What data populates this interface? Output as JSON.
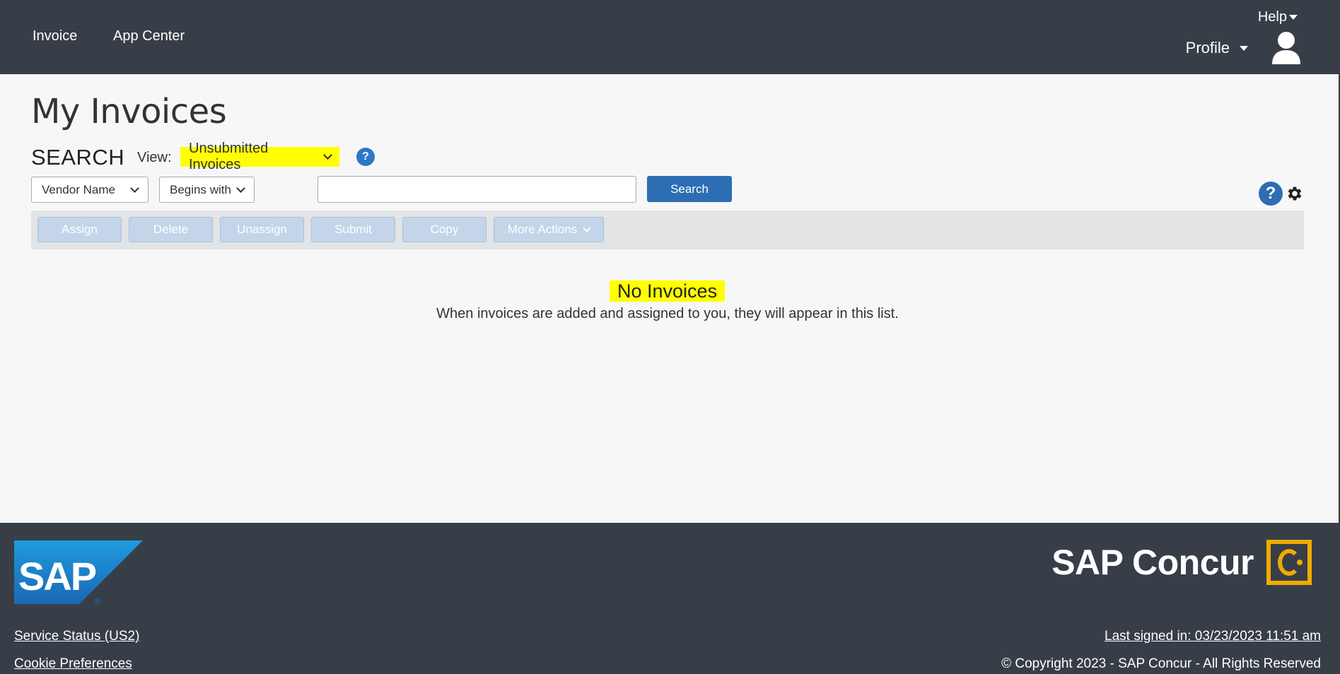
{
  "header": {
    "nav": [
      "Invoice",
      "App Center"
    ],
    "help_label": "Help",
    "profile_label": "Profile"
  },
  "page": {
    "title": "My Invoices"
  },
  "search": {
    "heading": "SEARCH",
    "view_label": "View:",
    "view_value": "Unsubmitted Invoices",
    "field_value": "Vendor Name",
    "operator_value": "Begins with",
    "query_value": "",
    "search_button": "Search"
  },
  "actions": [
    "Assign",
    "Delete",
    "Unassign",
    "Submit",
    "Copy",
    "More Actions"
  ],
  "empty_state": {
    "title": "No Invoices",
    "message": "When invoices are added and assigned to you, they will appear in this list."
  },
  "footer": {
    "brand_name": "SAP Concur",
    "service_status": "Service Status (US2)",
    "cookie_preferences": "Cookie Preferences",
    "last_signed_in": "Last signed in: 03/23/2023 11:51 am",
    "copyright": "© Copyright 2023 - SAP Concur - All Rights Reserved"
  },
  "icons": {
    "help_small": "question-circle-icon",
    "help_large": "question-circle-icon",
    "settings": "gear-icon",
    "avatar": "user-icon"
  },
  "colors": {
    "header_bg": "#383e47",
    "highlight": "#ffff00",
    "primary_button": "#2c6db4",
    "disabled_button": "#c4d5e9",
    "brand_accent": "#f0ab00"
  }
}
